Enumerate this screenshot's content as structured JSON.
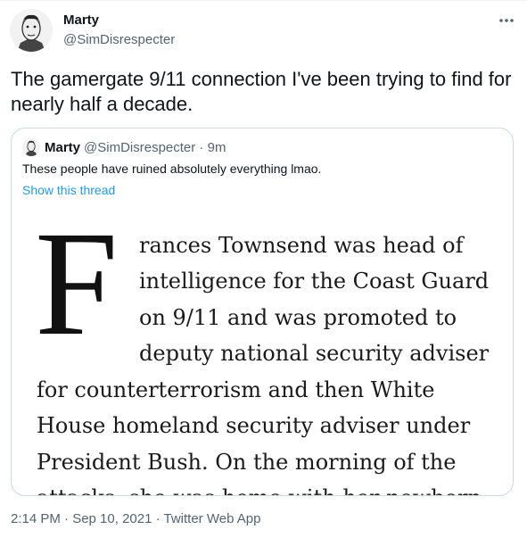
{
  "tweet": {
    "author": {
      "name": "Marty",
      "handle": "@SimDisrespecter"
    },
    "more_icon": "more-horizontal-icon",
    "text": "The gamergate 9/11 connection I've been trying to find for nearly half a decade.",
    "timestamp": "2:14 PM · Sep 10, 2021 · Twitter Web App"
  },
  "quote": {
    "name": "Marty",
    "meta": "@SimDisrespecter · 9m",
    "text": "These people have ruined absolutely everything lmao.",
    "show_thread": "Show this thread",
    "image": {
      "dropcap": "F",
      "lines": [
        "rances Townsend was head of",
        "intelligence for the Coast Guard",
        "on 9/11 and was promoted to",
        "deputy national security adviser",
        "for counterterrorism and then White",
        "House homeland security adviser under",
        "President Bush. On the morning of the",
        "attacks, she was home with her newborn"
      ]
    }
  },
  "colors": {
    "link": "#1d9bf0",
    "secondary": "#536471",
    "border": "#cfd9de"
  }
}
